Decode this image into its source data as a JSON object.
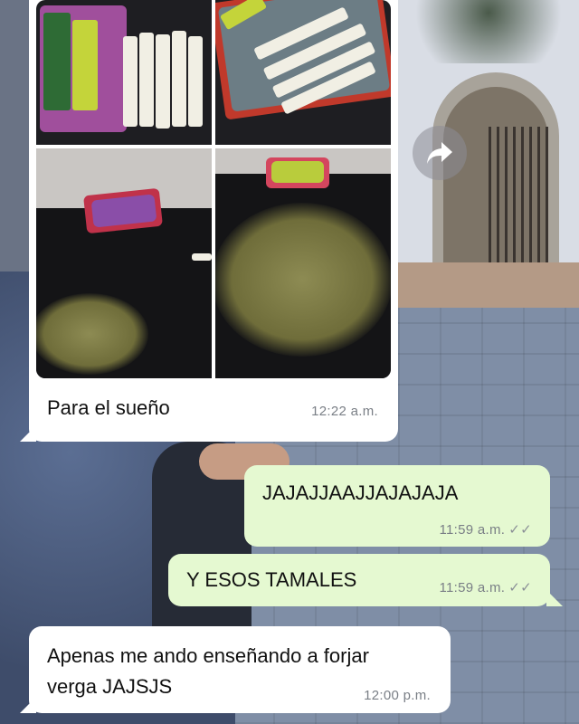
{
  "messages": [
    {
      "direction": "incoming",
      "type": "image",
      "caption": "Para el sueño",
      "time": "12:22 a.m."
    },
    {
      "direction": "outgoing",
      "text": "JAJAJJAAJJAJAJAJA",
      "time": "11:59 a.m.",
      "status": "read"
    },
    {
      "direction": "outgoing",
      "text": "Y ESOS TAMALES",
      "time": "11:59 a.m.",
      "status": "read"
    },
    {
      "direction": "incoming",
      "text": "Apenas me ando enseñando a forjar verga JAJSJS",
      "time": "12:00 p.m."
    }
  ],
  "icons": {
    "share": "forward-arrow-icon",
    "read_receipt": "double-check-icon"
  },
  "colors": {
    "incoming_bubble": "#ffffff",
    "outgoing_bubble": "#e5f9d1",
    "timestamp": "#7a7f86"
  }
}
